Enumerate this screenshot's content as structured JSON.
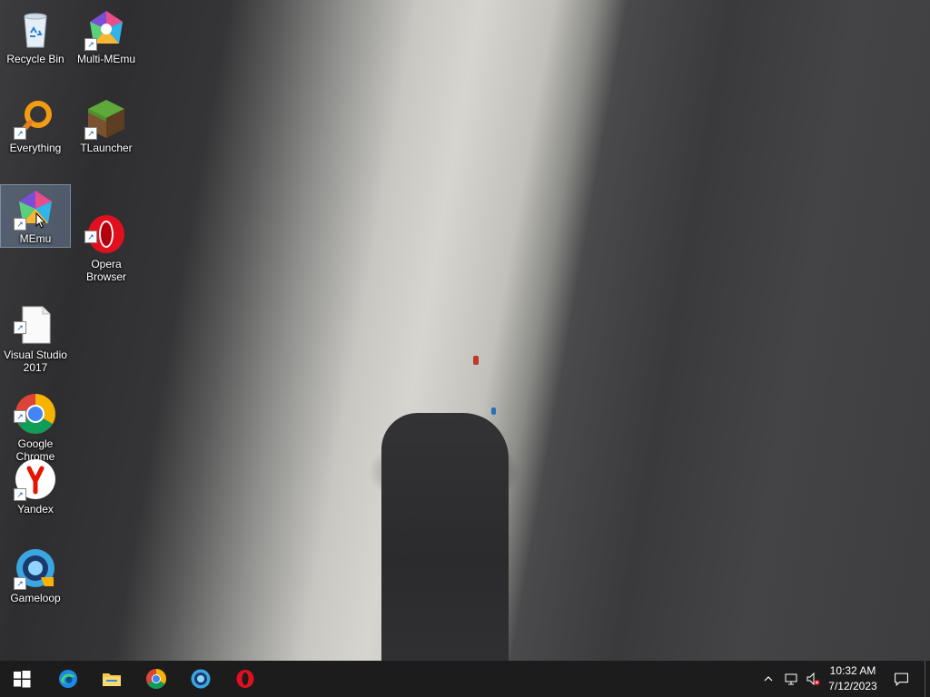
{
  "desktop": {
    "icons": [
      {
        "label": "Recycle Bin",
        "icon": "recycle-bin-icon"
      },
      {
        "label": "Multi-MEmu",
        "icon": "multi-memu-icon"
      },
      {
        "label": "Everything",
        "icon": "everything-search-icon"
      },
      {
        "label": "TLauncher",
        "icon": "tlauncher-icon"
      },
      {
        "label": "MEmu",
        "icon": "memu-icon"
      },
      {
        "label": "Opera\nBrowser",
        "icon": "opera-icon"
      },
      {
        "label": "Visual Studio\n2017",
        "icon": "blank-file-icon"
      },
      {
        "label": "Google\nChrome",
        "icon": "chrome-icon"
      },
      {
        "label": "Yandex",
        "icon": "yandex-icon"
      },
      {
        "label": "Gameloop",
        "icon": "gameloop-icon"
      }
    ],
    "selected": "MEmu"
  },
  "taskbar": {
    "pinned": [
      "start-icon",
      "edge-icon",
      "file-explorer-icon",
      "chrome-icon",
      "gameloop-icon",
      "opera-icon"
    ],
    "tray": [
      "show-hidden-icons-chevron",
      "network-icon",
      "volume-muted-icon"
    ],
    "time": "10:32 AM",
    "date": "7/12/2023",
    "notifications": "action-center-icon"
  },
  "colors": {
    "taskbar_bg": "#1c1c1c",
    "start_blue": "#ffffff",
    "opera_red": "#e0101f",
    "chrome_red": "#db4437",
    "chrome_yellow": "#f4b400",
    "chrome_green": "#0f9d58",
    "chrome_blue": "#4285f4"
  }
}
